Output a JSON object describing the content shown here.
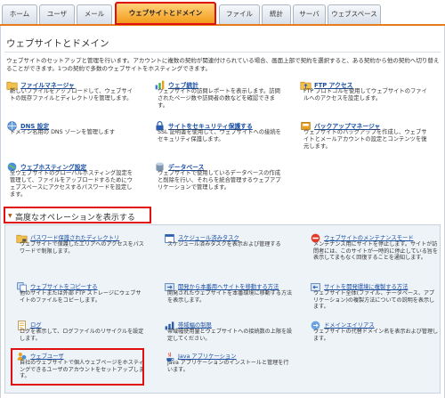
{
  "tabs": [
    "ホーム",
    "ユーザ",
    "メール",
    "ウェブサイトとドメイン",
    "ファイル",
    "統計",
    "サーバ",
    "ウェブスペース"
  ],
  "active_tab": "ウェブサイトとドメイン",
  "page_title": "ウェブサイトとドメイン",
  "intro": "ウェブサイトのセットアップと管理を行います。アカウントに複数の契約が関連付けられている場合、画面上部で契約を選択すると、ある契約から他の契約へ切り替えることができます。1つの契約で多数のウェブサイトをホスティングできます。",
  "tools": [
    {
      "title": "ファイルマネージャ",
      "desc": "新しいファイルをアップロードして、ウェブサイトの既存ファイルとディレクトリを管理します。",
      "icon": "folder-icon"
    },
    {
      "title": "ウェブ統計",
      "desc": "ウェブサイトの訪問レポートを表示します。訪問されたページ数や訪問者の数などを確認できます。",
      "icon": "stats-chart-icon"
    },
    {
      "title": "FTP アクセス",
      "desc": "FTP プロトコルを使用してウェブサイトのファイルへのアクセスを設定します。",
      "icon": "ftp-folder-icon"
    },
    {
      "title": "DNS 設定",
      "desc": "ドメイン名用の DNS ゾーンを管理します",
      "icon": "dns-icon"
    },
    {
      "title": "サイトをセキュリティ保護する",
      "desc": "SSL 証明書を使用して、ウェブサイトへの接続をセキュリティ保護します。",
      "icon": "lock-icon"
    },
    {
      "title": "バックアップマネージャ",
      "desc": "ウェブサイトのバックアップを作成し、ウェブサイトとメールアカウントの設定とコンテンツを復元します。",
      "icon": "backup-icon"
    },
    {
      "title": "ウェブホスティング設定",
      "desc": "全ウェブサイトのグローバルホスティング設定を管理して、ファイルをアップロードするためにウェブスペースにアクセスするパスワードを設定します。",
      "icon": "globe-icon"
    },
    {
      "title": "データベース",
      "desc": "ウェブサイトで使用しているデータベースの作成と削除を行い、それらを統合管理するウェブアプリケーションで管理します。",
      "icon": "database-icon"
    }
  ],
  "advanced_toggle": "高度なオペレーションを表示する",
  "advanced": [
    {
      "title": "パスワード保護されたディレクトリ",
      "desc": "ウェブサイトで保護したエリアへのアクセスをパスワードで制限します。",
      "icon": "protected-folder-icon"
    },
    {
      "title": "スケジュール済みタスク",
      "desc": "スケジュール済みタスクを表示および管理する",
      "icon": "calendar-icon"
    },
    {
      "title": "ウェブサイトのメンテナンスモード",
      "desc": "メンテナンス用にサイトを停止します。サイトが訪問者には、このサイトが一時的に停止している旨を表示してまもなく回復することを通知します。",
      "icon": "no-entry-icon"
    },
    {
      "title": "ウェブサイトをコピーする",
      "desc": "他のサイトまたは外部 FTP ストレージにウェブサイトのファイルをコピーします。",
      "icon": "copy-icon"
    },
    {
      "title": "開発から本番用へサイトを移動する方法",
      "desc": "開発されたウェブサイトを本番環境に移動する方法を表示します。",
      "icon": "move-site-icon"
    },
    {
      "title": "サイトを開発環境に複製する方法",
      "desc": "ウェブサイト全体(ファイル、データベース、アプリケーション)の複製方法についての説明を表示します。",
      "icon": "clone-site-icon"
    },
    {
      "title": "ログ",
      "desc": "ログを表示して、ログファイルのリサイクルを設定します。",
      "icon": "log-icon"
    },
    {
      "title": "帯域幅の制限",
      "desc": "帯域幅使用量とウェブサイトへの接続数の上限を設定してください。",
      "icon": "bandwidth-icon"
    },
    {
      "title": "ドメインエイリアス",
      "desc": "ウェブサイトの代替ドメイン名を表示および管理します。",
      "icon": "alias-icon"
    },
    {
      "title": "ウェブユーザ",
      "desc": "自社のウェブサイトで個人ウェブページをホスティングできるユーザのアカウントをセットアップします。",
      "icon": "web-users-icon"
    },
    {
      "title": "Java アプリケーション",
      "desc": "Java アプリケーションのインストールと管理を行います。",
      "icon": "java-icon"
    }
  ]
}
